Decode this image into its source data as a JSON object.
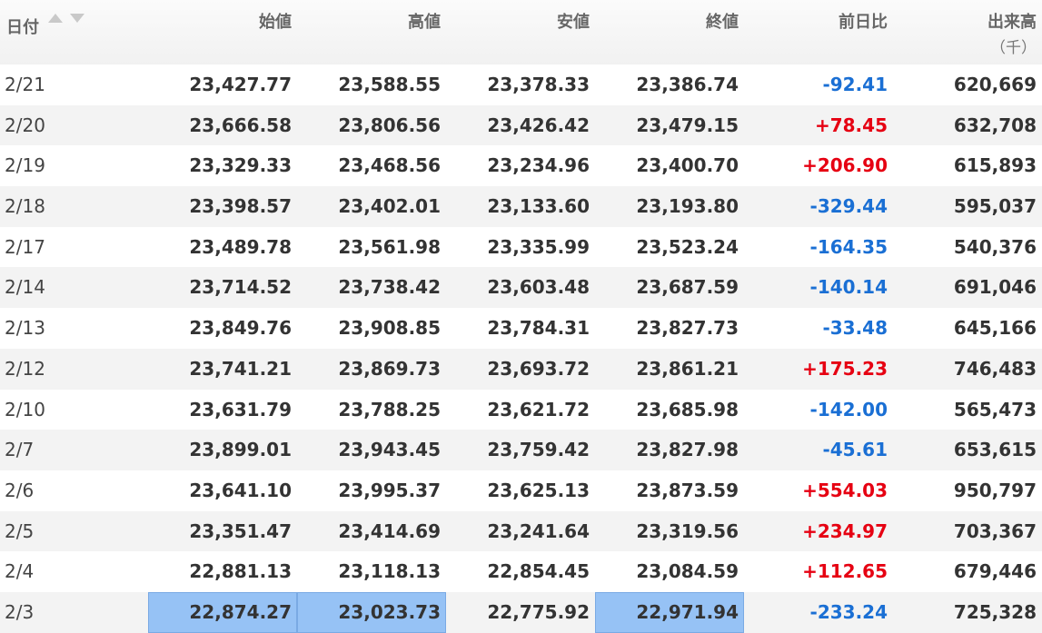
{
  "columns": {
    "date": "日付",
    "open": "始値",
    "high": "高値",
    "low": "安値",
    "close": "終値",
    "change": "前日比",
    "volume": "出来高",
    "volume_unit": "（千）"
  },
  "colors": {
    "positive": "#e60012",
    "negative": "#1a6fd4",
    "highlight": "#96c2f5"
  },
  "rows": [
    {
      "date": "2/21",
      "open": "23,427.77",
      "high": "23,588.55",
      "low": "23,378.33",
      "close": "23,386.74",
      "change": "-92.41",
      "volume": "620,669"
    },
    {
      "date": "2/20",
      "open": "23,666.58",
      "high": "23,806.56",
      "low": "23,426.42",
      "close": "23,479.15",
      "change": "+78.45",
      "volume": "632,708"
    },
    {
      "date": "2/19",
      "open": "23,329.33",
      "high": "23,468.56",
      "low": "23,234.96",
      "close": "23,400.70",
      "change": "+206.90",
      "volume": "615,893"
    },
    {
      "date": "2/18",
      "open": "23,398.57",
      "high": "23,402.01",
      "low": "23,133.60",
      "close": "23,193.80",
      "change": "-329.44",
      "volume": "595,037"
    },
    {
      "date": "2/17",
      "open": "23,489.78",
      "high": "23,561.98",
      "low": "23,335.99",
      "close": "23,523.24",
      "change": "-164.35",
      "volume": "540,376"
    },
    {
      "date": "2/14",
      "open": "23,714.52",
      "high": "23,738.42",
      "low": "23,603.48",
      "close": "23,687.59",
      "change": "-140.14",
      "volume": "691,046"
    },
    {
      "date": "2/13",
      "open": "23,849.76",
      "high": "23,908.85",
      "low": "23,784.31",
      "close": "23,827.73",
      "change": "-33.48",
      "volume": "645,166"
    },
    {
      "date": "2/12",
      "open": "23,741.21",
      "high": "23,869.73",
      "low": "23,693.72",
      "close": "23,861.21",
      "change": "+175.23",
      "volume": "746,483"
    },
    {
      "date": "2/10",
      "open": "23,631.79",
      "high": "23,788.25",
      "low": "23,621.72",
      "close": "23,685.98",
      "change": "-142.00",
      "volume": "565,473"
    },
    {
      "date": "2/7",
      "open": "23,899.01",
      "high": "23,943.45",
      "low": "23,759.42",
      "close": "23,827.98",
      "change": "-45.61",
      "volume": "653,615"
    },
    {
      "date": "2/6",
      "open": "23,641.10",
      "high": "23,995.37",
      "low": "23,625.13",
      "close": "23,873.59",
      "change": "+554.03",
      "volume": "950,797"
    },
    {
      "date": "2/5",
      "open": "23,351.47",
      "high": "23,414.69",
      "low": "23,241.64",
      "close": "23,319.56",
      "change": "+234.97",
      "volume": "703,367"
    },
    {
      "date": "2/4",
      "open": "22,881.13",
      "high": "23,118.13",
      "low": "22,854.45",
      "close": "23,084.59",
      "change": "+112.65",
      "volume": "679,446"
    },
    {
      "date": "2/3",
      "open": "22,874.27",
      "high": "23,023.73",
      "low": "22,775.92",
      "close": "22,971.94",
      "change": "-233.24",
      "volume": "725,328",
      "highlighted": [
        "open",
        "high",
        "close"
      ]
    }
  ]
}
